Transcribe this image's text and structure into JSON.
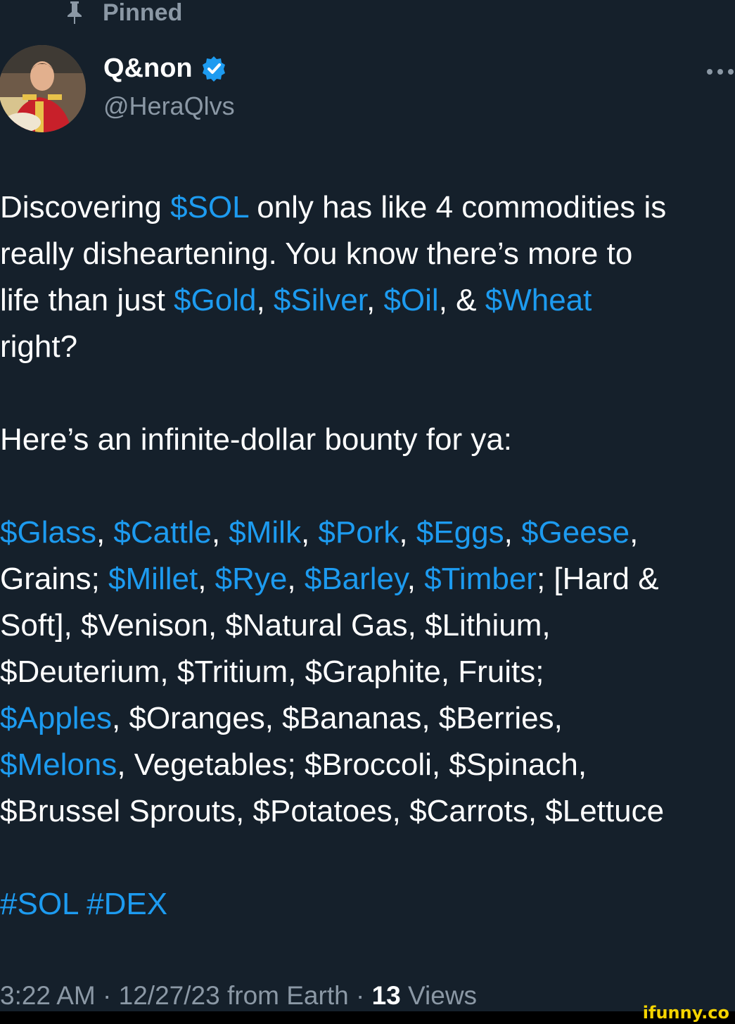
{
  "pinned": {
    "icon": "pin-icon",
    "label": "Pinned"
  },
  "author": {
    "name": "Q&non",
    "handle": "@HeraQlvs",
    "verified_icon": "verified-badge-icon",
    "avatar": "avatar-portrait"
  },
  "more_icon": "more-options-icon",
  "tweet": {
    "lines": [
      [
        {
          "t": "Discovering "
        },
        {
          "t": "$SOL",
          "link": true
        },
        {
          "t": " only has like 4 commodities is"
        }
      ],
      [
        {
          "t": "really disheartening. You know there’s more to"
        }
      ],
      [
        {
          "t": "life than just "
        },
        {
          "t": "$Gold",
          "link": true
        },
        {
          "t": ", "
        },
        {
          "t": "$Silver",
          "link": true
        },
        {
          "t": ", "
        },
        {
          "t": "$Oil",
          "link": true
        },
        {
          "t": ", & "
        },
        {
          "t": "$Wheat",
          "link": true
        }
      ],
      [
        {
          "t": "right?"
        }
      ],
      [
        {
          "t": ""
        }
      ],
      [
        {
          "t": "Here’s an infinite-dollar bounty for ya:"
        }
      ],
      [
        {
          "t": ""
        }
      ],
      [
        {
          "t": "$Glass",
          "link": true
        },
        {
          "t": ", "
        },
        {
          "t": "$Cattle",
          "link": true
        },
        {
          "t": ", "
        },
        {
          "t": "$Milk",
          "link": true
        },
        {
          "t": ", "
        },
        {
          "t": "$Pork",
          "link": true
        },
        {
          "t": ", "
        },
        {
          "t": "$Eggs",
          "link": true
        },
        {
          "t": ", "
        },
        {
          "t": "$Geese",
          "link": true
        },
        {
          "t": ","
        }
      ],
      [
        {
          "t": "Grains; "
        },
        {
          "t": "$Millet",
          "link": true
        },
        {
          "t": ", "
        },
        {
          "t": "$Rye",
          "link": true
        },
        {
          "t": ", "
        },
        {
          "t": "$Barley",
          "link": true
        },
        {
          "t": ", "
        },
        {
          "t": "$Timber",
          "link": true
        },
        {
          "t": "; [Hard &"
        }
      ],
      [
        {
          "t": "Soft], $Venison, $Natural Gas, $Lithium,"
        }
      ],
      [
        {
          "t": "$Deuterium, $Tritium, $Graphite, Fruits;"
        }
      ],
      [
        {
          "t": "$Apples",
          "link": true
        },
        {
          "t": ", $Oranges, $Bananas, $Berries,"
        }
      ],
      [
        {
          "t": "$Melons",
          "link": true
        },
        {
          "t": ", Vegetables; $Broccoli, $Spinach,"
        }
      ],
      [
        {
          "t": "$Brussel Sprouts, $Potatoes, $Carrots, $Lettuce"
        }
      ],
      [
        {
          "t": ""
        }
      ],
      [
        {
          "t": "#SOL",
          "link": true
        },
        {
          "t": " "
        },
        {
          "t": "#DEX",
          "link": true
        }
      ]
    ]
  },
  "meta": {
    "time": "3:22 AM",
    "sep1": " · ",
    "date": "12/27/23",
    "source": " from Earth",
    "sep2": " · ",
    "views_count": "13",
    "views_label": " Views"
  },
  "watermark": "ifunny.co",
  "colors": {
    "background": "#15202b",
    "link": "#1d9bf0",
    "secondary_text": "#8b98a5",
    "watermark": "#f5d400"
  }
}
